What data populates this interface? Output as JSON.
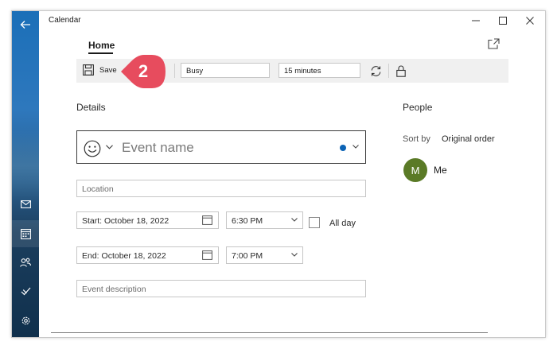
{
  "window": {
    "title": "Calendar"
  },
  "rail": {
    "items": [
      "back-arrow-icon",
      "mail-icon",
      "calendar-icon",
      "people-icon",
      "todo-icon",
      "settings-icon"
    ],
    "active": "calendar-icon"
  },
  "caption": {
    "minimize": "minimize-icon",
    "maximize": "maximize-icon",
    "close": "close-icon"
  },
  "tabs": {
    "home_label": "Home"
  },
  "toolbar": {
    "save_label": "Save",
    "delete_fragment": "e",
    "show_as": "Busy",
    "reminder": "15 minutes"
  },
  "step_marker": {
    "number": "2",
    "color": "#e74c5e"
  },
  "details": {
    "title": "Details",
    "event_name_placeholder": "Event name",
    "calendar_color": "#0b63b5",
    "location_placeholder": "Location",
    "start_label": "Start:",
    "start_date": "October 18, 2022",
    "start_time": "6:30 PM",
    "all_day_label": "All day",
    "end_label": "End:",
    "end_date": "October 18, 2022",
    "end_time": "7:00 PM",
    "description_placeholder": "Event description"
  },
  "people": {
    "title": "People",
    "sort_by_label": "Sort by",
    "sort_by_value": "Original order",
    "attendees": [
      {
        "initial": "M",
        "name": "Me",
        "avatar_color": "#5a7a26"
      }
    ]
  }
}
